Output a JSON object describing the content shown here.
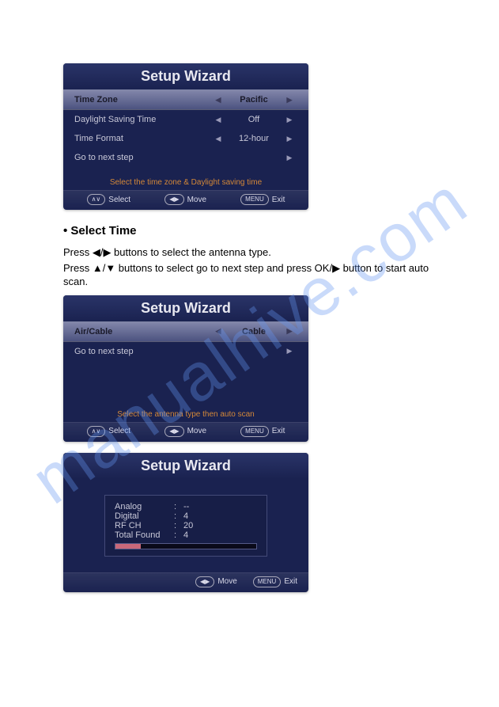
{
  "watermark": "manualhive.com",
  "screen1": {
    "title": "Setup Wizard",
    "rows": [
      {
        "label": "Time Zone",
        "value": "Pacific",
        "hl": true
      },
      {
        "label": "Daylight Saving Time",
        "value": "Off",
        "hl": false
      },
      {
        "label": "Time Format",
        "value": "12-hour",
        "hl": false
      },
      {
        "label": "Go to next step",
        "value": "",
        "hl": false
      }
    ],
    "hint": "Select the time zone & Daylight saving time",
    "footer": {
      "select": "Select",
      "move": "Move",
      "exit": "Exit",
      "menu": "MENU"
    }
  },
  "section_heading": "• Select Time",
  "para1": "Press ◀/▶ buttons to select the antenna type.",
  "para2": "Press ▲/▼ buttons to select go to next step and press OK/▶ button to start auto scan.",
  "screen2": {
    "title": "Setup Wizard",
    "rows": [
      {
        "label": "Air/Cable",
        "value": "Cable",
        "hl": true
      },
      {
        "label": "Go to next step",
        "value": "",
        "hl": false
      }
    ],
    "hint": "Select the antenna type then auto scan",
    "footer": {
      "select": "Select",
      "move": "Move",
      "exit": "Exit",
      "menu": "MENU"
    }
  },
  "screen3": {
    "title": "Setup Wizard",
    "scan": [
      {
        "l": "Analog",
        "v": "--"
      },
      {
        "l": "Digital",
        "v": "4"
      },
      {
        "l": "RF CH",
        "v": "20"
      },
      {
        "l": "Total Found",
        "v": "4"
      }
    ],
    "footer": {
      "move": "Move",
      "exit": "Exit",
      "menu": "MENU"
    }
  }
}
